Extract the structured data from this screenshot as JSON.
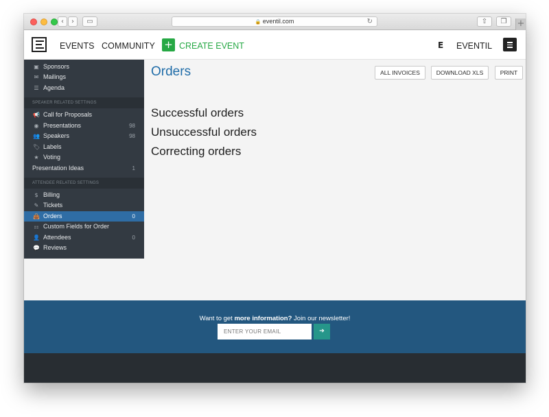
{
  "browser": {
    "url": "eventil.com",
    "lock_icon": "🔒",
    "back_icon": "‹",
    "forward_icon": "›",
    "sidebar_toggle_icon": "▭",
    "reload_icon": "↻",
    "share_icon": "⇧",
    "tabs_icon": "❐",
    "new_tab_icon": "+"
  },
  "nav": {
    "logo_icon": "E",
    "events_label": "EVENTS",
    "community_label": "COMMUNITY",
    "create_plus_icon": "+",
    "create_label": "CREATE EVENT",
    "brand_icon": "E",
    "brand_name": "EVENTIL",
    "accent_color": "#26a844"
  },
  "sidebar": {
    "items_top": [
      {
        "icon": "▣",
        "label": "Sponsors",
        "count": ""
      },
      {
        "icon": "✉",
        "label": "Mailings",
        "count": ""
      },
      {
        "icon": "☰",
        "label": "Agenda",
        "count": ""
      }
    ],
    "speaker_heading": "SPEAKER RELATED SETTINGS",
    "items_speaker": [
      {
        "icon": "📢",
        "label": "Call for Proposals",
        "count": ""
      },
      {
        "icon": "◉",
        "label": "Presentations",
        "count": "98"
      },
      {
        "icon": "👥",
        "label": "Speakers",
        "count": "98"
      },
      {
        "icon": "🏷",
        "label": "Labels",
        "count": ""
      },
      {
        "icon": "★",
        "label": "Voting",
        "count": ""
      },
      {
        "icon": "",
        "label": "Presentation Ideas",
        "count": "1"
      }
    ],
    "attendee_heading": "ATTENDEE RELATED SETTINGS",
    "items_attendee": [
      {
        "icon": "$",
        "label": "Billing",
        "count": ""
      },
      {
        "icon": "✎",
        "label": "Tickets",
        "count": ""
      },
      {
        "icon": "👜",
        "label": "Orders",
        "count": "0"
      },
      {
        "icon": "⚏",
        "label": "Custom Fields for Order",
        "count": ""
      },
      {
        "icon": "👤",
        "label": "Attendees",
        "count": "0"
      },
      {
        "icon": "💬",
        "label": "Reviews",
        "count": ""
      }
    ],
    "active_color": "#2f6da5"
  },
  "main": {
    "title": "Orders",
    "buttons": {
      "all_invoices": "ALL INVOICES",
      "download_xls": "DOWNLOAD XLS",
      "print": "PRINT"
    },
    "links": [
      "Successful orders",
      "Unsuccessful orders",
      "Correcting orders"
    ],
    "title_color": "#1f6ca8"
  },
  "newsletter": {
    "text_prefix": "Want to get ",
    "text_bold": "more information?",
    "text_suffix": " Join our newsletter!",
    "placeholder": "ENTER YOUR EMAIL",
    "submit_icon": "➔",
    "background": "#23577f"
  }
}
